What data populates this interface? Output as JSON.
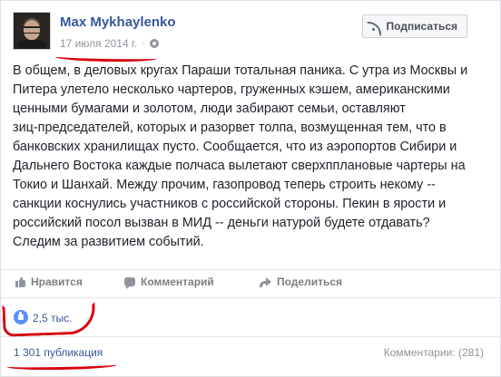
{
  "post": {
    "author": "Max Mykhaylenko",
    "date": "17 июля 2014 г.",
    "separator": "·",
    "follow_label": "Подписаться",
    "text": "В общем, в деловых кругах Параши тотальная паника. С утра из Москвы и\nПитера улетело несколько чартеров, груженных кэшем, американскими\nценными бумагами и золотом, люди забирают семьи, оставляют\nзиц-председателей, которых и разорвет толпа, возмущенная тем, что в\nбанковских хранилищах пусто. Сообщается, что из аэропортов Сибири и\nДальнего Востока каждые полчаса вылетают сверхпплановые чартеры на\nТокио и Шанхай. Между прочим, газопровод теперь строить некому --\nсанкции коснулись участников с российской стороны. Пекин в ярости и\nроссийский посол вызван в МИД -- деньги натурой будете отдавать?\nСледим за развитием событий."
  },
  "actions": {
    "like": "Нравится",
    "comment": "Комментарий",
    "share": "Поделиться"
  },
  "stats": {
    "likes": "2,5 тыс.",
    "shares": "1 301 публикация",
    "comments": "Комментарии: (281)"
  },
  "icons": {
    "follow": "rss-icon",
    "privacy": "globe-icon",
    "like": "thumbs-up-icon",
    "comment": "comment-bubble-icon",
    "share": "share-arrow-icon",
    "like_badge": "like-badge-icon"
  },
  "colors": {
    "link": "#365899",
    "muted": "#90949c",
    "annotation": "#d8000c",
    "like_badge": "#5890ff"
  }
}
